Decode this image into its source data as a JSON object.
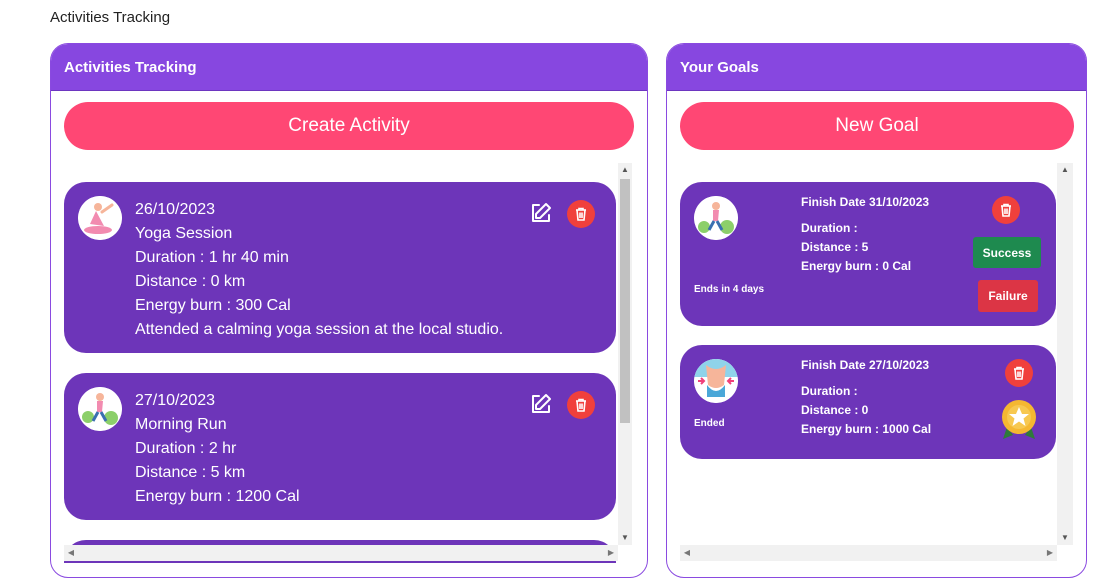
{
  "page_title": "Activities Tracking",
  "activities_panel": {
    "title": "Activities Tracking",
    "create_button": "Create Activity",
    "activities": [
      {
        "date": "26/10/2023",
        "name": "Yoga Session",
        "duration": "Duration : 1 hr 40 min",
        "distance": "Distance : 0 km",
        "energy": "Energy burn : 300 Cal",
        "note": "Attended a calming yoga session at the local studio.",
        "avatar_icon": "yoga-avatar-icon"
      },
      {
        "date": "27/10/2023",
        "name": "Morning Run",
        "duration": "Duration : 2 hr",
        "distance": "Distance : 5 km",
        "energy": "Energy burn : 1200 Cal",
        "avatar_icon": "running-avatar-icon"
      }
    ]
  },
  "goals_panel": {
    "title": "Your Goals",
    "new_button": "New Goal",
    "goals": [
      {
        "finish": "Finish Date 31/10/2023",
        "duration": "Duration :",
        "distance": "Distance : 5",
        "energy": "Energy burn : 0 Cal",
        "status": "Ends in 4 days",
        "success_label": "Success",
        "failure_label": "Failure",
        "avatar_icon": "running-avatar-icon"
      },
      {
        "finish": "Finish Date 27/10/2023",
        "duration": "Duration :",
        "distance": "Distance : 0",
        "energy": "Energy burn : 1000 Cal",
        "status": "Ended",
        "avatar_icon": "waist-avatar-icon",
        "badge_icon": "star-medal-icon"
      }
    ]
  },
  "colors": {
    "header": "#8747e0",
    "card": "#6d35b9",
    "accent_button": "#ff4774",
    "delete": "#f0403c",
    "success": "#1e8a4f",
    "failure": "#dc3545"
  }
}
